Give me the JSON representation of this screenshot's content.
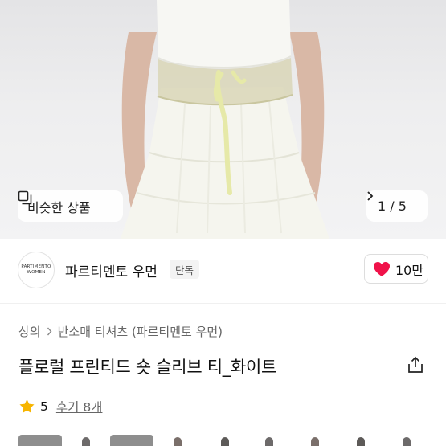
{
  "gallery": {
    "similar_label": "비슷한 상품",
    "counter": "1 / 5"
  },
  "brand": {
    "logo_line1": "PARTIMENTO",
    "logo_line2": "WOMEN",
    "name": "파르티멘토 우먼",
    "badge": "단독",
    "like_count": "10만"
  },
  "breadcrumb": {
    "category": "상의",
    "subcategory": "반소매 티셔츠 (파르티멘토 우먼)"
  },
  "product": {
    "title": "플로럴 프린티드 숏 슬리브 티_화이트"
  },
  "rating": {
    "score": "5",
    "reviews": "후기 8개"
  },
  "colors": {
    "heart": "#f0124a",
    "star": "#f7b500"
  }
}
